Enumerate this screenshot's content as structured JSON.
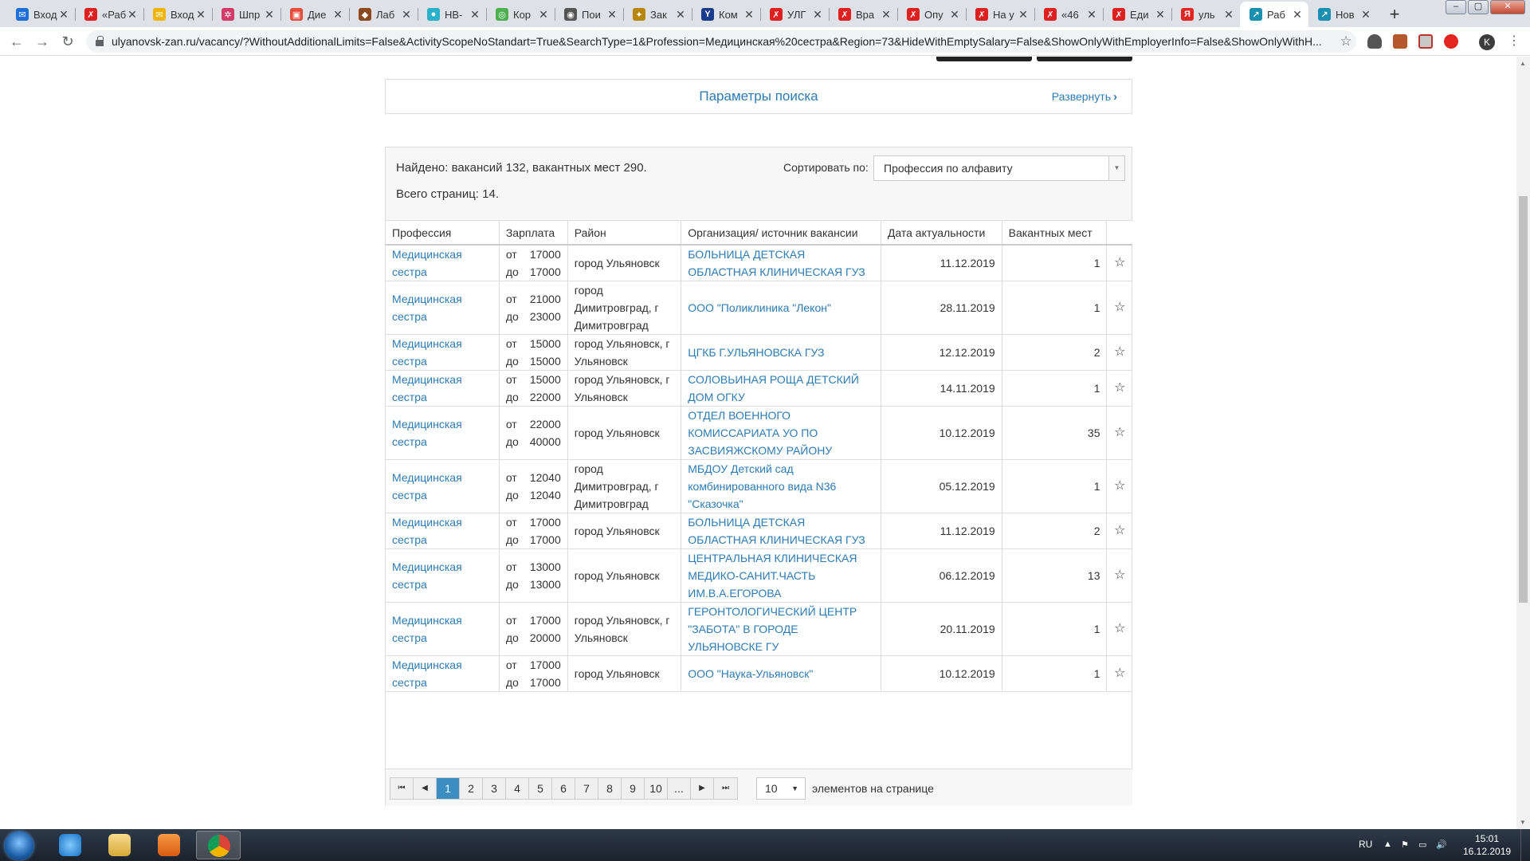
{
  "browser": {
    "tabs": [
      {
        "title": "Вход",
        "fav_color": "#1e6fd9",
        "fav_glyph": "✉"
      },
      {
        "title": "«Раб",
        "fav_color": "#e02020",
        "fav_glyph": "✗"
      },
      {
        "title": "Вход",
        "fav_color": "#f2b400",
        "fav_glyph": "✉"
      },
      {
        "title": "Шпр",
        "fav_color": "#d23b6a",
        "fav_glyph": "✲"
      },
      {
        "title": "Дие",
        "fav_color": "#e74c3c",
        "fav_glyph": "▣"
      },
      {
        "title": "Лаб",
        "fav_color": "#8b4a1f",
        "fav_glyph": "◆"
      },
      {
        "title": "НВ-",
        "fav_color": "#2bb0c9",
        "fav_glyph": "●"
      },
      {
        "title": "Кор",
        "fav_color": "#4caf50",
        "fav_glyph": "◎"
      },
      {
        "title": "Пои",
        "fav_color": "#555555",
        "fav_glyph": "◉"
      },
      {
        "title": "Зак",
        "fav_color": "#b8860b",
        "fav_glyph": "✦"
      },
      {
        "title": "Ком",
        "fav_color": "#1a3a8c",
        "fav_glyph": "Y"
      },
      {
        "title": "УЛГ",
        "fav_color": "#e02020",
        "fav_glyph": "✗"
      },
      {
        "title": "Вра",
        "fav_color": "#e02020",
        "fav_glyph": "✗"
      },
      {
        "title": "Опу",
        "fav_color": "#e02020",
        "fav_glyph": "✗"
      },
      {
        "title": "На у",
        "fav_color": "#e02020",
        "fav_glyph": "✗"
      },
      {
        "title": "«46",
        "fav_color": "#e02020",
        "fav_glyph": "✗"
      },
      {
        "title": "Еди",
        "fav_color": "#e02020",
        "fav_glyph": "✗"
      },
      {
        "title": "уль",
        "fav_color": "#e52620",
        "fav_glyph": "Я"
      },
      {
        "title": "Раб",
        "fav_color": "#1b8fb0",
        "fav_glyph": "↗",
        "active": true
      },
      {
        "title": "Нов",
        "fav_color": "#1b8fb0",
        "fav_glyph": "↗"
      }
    ],
    "new_tab_glyph": "+",
    "window_buttons": {
      "minimize": "–",
      "maximize": "▢",
      "close": "✕"
    },
    "nav": {
      "back": "←",
      "forward": "→",
      "reload": "↻"
    },
    "url": "ulyanovsk-zan.ru/vacancy/?WithoutAdditionalLimits=False&ActivityScopeNoStandart=True&SearchType=1&Profession=Медицинская%20сестра&Region=73&HideWithEmptySalary=False&ShowOnlyWithEmployerInfo=False&ShowOnlyWithH...",
    "bookmark_star": "☆",
    "profile_initial": "K",
    "menu_glyph": "⋮"
  },
  "search_params": {
    "title": "Параметры поиска",
    "expand_label": "Развернуть",
    "expand_glyph": "›"
  },
  "results": {
    "found_text": "Найдено: вакансий 132, вакантных мест 290.",
    "pages_text": "Всего страниц: 14.",
    "sort_label": "Сортировать по:",
    "sort_value": "Профессия по алфавиту",
    "columns": [
      "Профессия",
      "Зарплата",
      "Район",
      "Организация/ источник вакансии",
      "Дата актуальности",
      "Вакантных мест"
    ],
    "salary_from_label": "от",
    "salary_to_label": "до",
    "favorite_glyph": "☆",
    "rows": [
      {
        "profession": "Медицинская сестра",
        "from": "17000",
        "to": "17000",
        "district": "город Ульяновск",
        "org": "БОЛЬНИЦА ДЕТСКАЯ ОБЛАСТНАЯ КЛИНИЧЕСКАЯ ГУЗ",
        "date": "11.12.2019",
        "vacancies": "1"
      },
      {
        "profession": "Медицинская сестра",
        "from": "21000",
        "to": "23000",
        "district": "город Димитровград, г Димитровград",
        "org": "ООО \"Поликлиника \"Лекон\"",
        "date": "28.11.2019",
        "vacancies": "1"
      },
      {
        "profession": "Медицинская сестра",
        "from": "15000",
        "to": "15000",
        "district": "город Ульяновск, г Ульяновск",
        "org": "ЦГКБ Г.УЛЬЯНОВСКА ГУЗ",
        "date": "12.12.2019",
        "vacancies": "2"
      },
      {
        "profession": "Медицинская сестра",
        "from": "15000",
        "to": "22000",
        "district": "город Ульяновск, г Ульяновск",
        "org": "СОЛОВЬИНАЯ РОЩА ДЕТСКИЙ ДОМ ОГКУ",
        "date": "14.11.2019",
        "vacancies": "1"
      },
      {
        "profession": "Медицинская сестра",
        "from": "22000",
        "to": "40000",
        "district": "город Ульяновск",
        "org": "ОТДЕЛ ВОЕННОГО КОМИССАРИАТА УО ПО ЗАСВИЯЖСКОМУ РАЙОНУ",
        "date": "10.12.2019",
        "vacancies": "35"
      },
      {
        "profession": "Медицинская сестра",
        "from": "12040",
        "to": "12040",
        "district": "город Димитровград, г Димитровград",
        "org": "МБДОУ Детский сад комбинированного вида N36 \"Сказочка\"",
        "date": "05.12.2019",
        "vacancies": "1"
      },
      {
        "profession": "Медицинская сестра",
        "from": "17000",
        "to": "17000",
        "district": "город Ульяновск",
        "org": "БОЛЬНИЦА ДЕТСКАЯ ОБЛАСТНАЯ КЛИНИЧЕСКАЯ ГУЗ",
        "date": "11.12.2019",
        "vacancies": "2"
      },
      {
        "profession": "Медицинская сестра",
        "from": "13000",
        "to": "13000",
        "district": "город Ульяновск",
        "org": "ЦЕНТРАЛЬНАЯ КЛИНИЧЕСКАЯ МЕДИКО-САНИТ.ЧАСТЬ ИМ.В.А.ЕГОРОВА",
        "date": "06.12.2019",
        "vacancies": "13"
      },
      {
        "profession": "Медицинская сестра",
        "from": "17000",
        "to": "20000",
        "district": "город Ульяновск, г Ульяновск",
        "org": "ГЕРОНТОЛОГИЧЕСКИЙ ЦЕНТР \"ЗАБОТА\" В ГОРОДЕ УЛЬЯНОВСКЕ ГУ",
        "date": "20.11.2019",
        "vacancies": "1"
      },
      {
        "profession": "Медицинская сестра",
        "from": "17000",
        "to": "17000",
        "district": "город Ульяновск",
        "org": "ООО \"Наука-Ульяновск\"",
        "date": "10.12.2019",
        "vacancies": "1"
      }
    ]
  },
  "pager": {
    "first": "⏮",
    "prev": "◀",
    "pages": [
      "1",
      "2",
      "3",
      "4",
      "5",
      "6",
      "7",
      "8",
      "9",
      "10",
      "..."
    ],
    "current": "1",
    "next": "▶",
    "last": "⏭",
    "page_size": "10",
    "page_size_label": "элементов на странице"
  },
  "taskbar": {
    "lang": "RU",
    "time": "15:01",
    "date": "16.12.2019",
    "tray_up": "▲",
    "tray_flag": "⚑",
    "tray_network": "▭",
    "tray_volume": "🔊"
  }
}
